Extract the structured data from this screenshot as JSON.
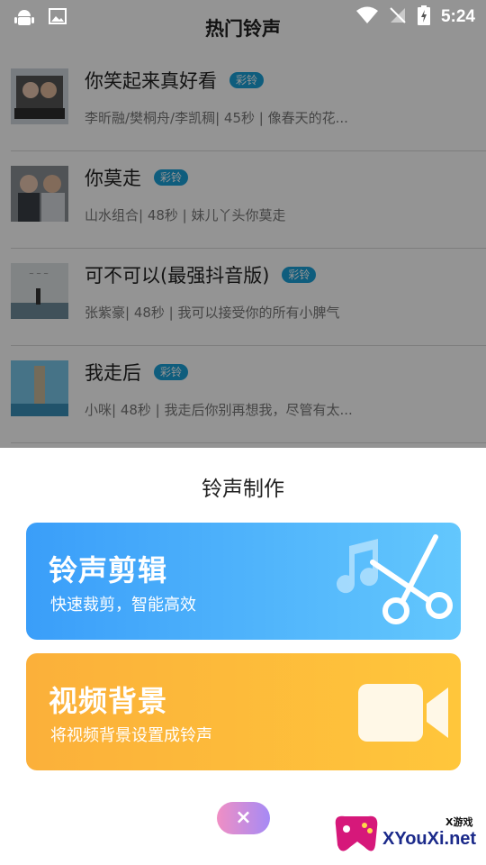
{
  "status_bar": {
    "time": "5:24"
  },
  "header": {
    "title": "热门铃声"
  },
  "songs": [
    {
      "title": "你笑起来真好看",
      "badge": "彩铃",
      "meta": "李昕融/樊桐舟/李凯稠| 45秒 |  像春天的花..."
    },
    {
      "title": "你莫走",
      "badge": "彩铃",
      "meta": "山水组合| 48秒 |  妹儿丫头你莫走"
    },
    {
      "title": "可不可以(最强抖音版)",
      "badge": "彩铃",
      "meta": "张紫豪| 48秒 |  我可以接受你的所有小脾气"
    },
    {
      "title": "我走后",
      "badge": "彩铃",
      "meta": "小咪| 48秒 |  我走后你别再想我，尽管有太..."
    }
  ],
  "sheet": {
    "title": "铃声制作",
    "cards": [
      {
        "title": "铃声剪辑",
        "subtitle": "快速裁剪，智能高效"
      },
      {
        "title": "视频背景",
        "subtitle": "将视频背景设置成铃声"
      }
    ],
    "close_label": "×"
  },
  "watermark": {
    "text": "XYouXi.net",
    "tag": "X游戏"
  },
  "colors": {
    "blue_card": "#3a9ef9",
    "orange_card": "#fbb03a",
    "badge": "#1aa1d8"
  }
}
